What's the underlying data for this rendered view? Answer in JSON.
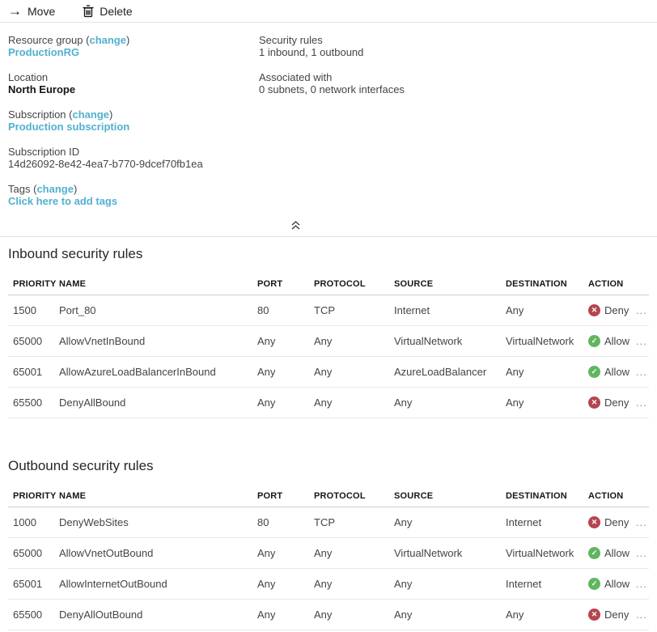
{
  "toolbar": {
    "move": "Move",
    "delete": "Delete"
  },
  "punctuation": {
    "open_paren": "(",
    "close_paren": ")"
  },
  "essentials": {
    "resource_group": {
      "label": "Resource group",
      "change": "change",
      "value": "ProductionRG"
    },
    "location": {
      "label": "Location",
      "value": "North Europe"
    },
    "subscription": {
      "label": "Subscription",
      "change": "change",
      "value": "Production subscription"
    },
    "subscription_id": {
      "label": "Subscription ID",
      "value": "14d26092-8e42-4ea7-b770-9dcef70fb1ea"
    },
    "tags": {
      "label": "Tags",
      "change": "change",
      "value": "Click here to add tags"
    },
    "security_rules": {
      "label": "Security rules",
      "value": "1 inbound, 1 outbound"
    },
    "associated_with": {
      "label": "Associated with",
      "value": "0 subnets, 0 network interfaces"
    }
  },
  "icons": {
    "move": "arrow-right-icon",
    "move_glyph": "→",
    "delete": "trash-icon",
    "collapse": "chevron-double-up-icon",
    "allow": "check-circle-icon",
    "check_glyph": "✓",
    "deny": "x-circle-icon",
    "cross_glyph": "✕"
  },
  "colors": {
    "link": "#52b0cf",
    "allow": "#60b65f",
    "deny": "#b6444f"
  },
  "misc": {
    "ellipsis": "...",
    "allow_label": "Allow",
    "deny_label": "Deny"
  },
  "tables": {
    "headers": [
      "PRIORITY",
      "NAME",
      "PORT",
      "PROTOCOL",
      "SOURCE",
      "DESTINATION",
      "ACTION"
    ],
    "inbound": {
      "title": "Inbound security rules",
      "rows": [
        {
          "priority": "1500",
          "name": "Port_80",
          "port": "80",
          "protocol": "TCP",
          "source": "Internet",
          "destination": "Any",
          "action": "Deny"
        },
        {
          "priority": "65000",
          "name": "AllowVnetInBound",
          "port": "Any",
          "protocol": "Any",
          "source": "VirtualNetwork",
          "destination": "VirtualNetwork",
          "action": "Allow"
        },
        {
          "priority": "65001",
          "name": "AllowAzureLoadBalancerInBound",
          "port": "Any",
          "protocol": "Any",
          "source": "AzureLoadBalancer",
          "destination": "Any",
          "action": "Allow"
        },
        {
          "priority": "65500",
          "name": "DenyAllBound",
          "port": "Any",
          "protocol": "Any",
          "source": "Any",
          "destination": "Any",
          "action": "Deny"
        }
      ]
    },
    "outbound": {
      "title": "Outbound security rules",
      "rows": [
        {
          "priority": "1000",
          "name": "DenyWebSites",
          "port": "80",
          "protocol": "TCP",
          "source": "Any",
          "destination": "Internet",
          "action": "Deny"
        },
        {
          "priority": "65000",
          "name": "AllowVnetOutBound",
          "port": "Any",
          "protocol": "Any",
          "source": "VirtualNetwork",
          "destination": "VirtualNetwork",
          "action": "Allow"
        },
        {
          "priority": "65001",
          "name": "AllowInternetOutBound",
          "port": "Any",
          "protocol": "Any",
          "source": "Any",
          "destination": "Internet",
          "action": "Allow"
        },
        {
          "priority": "65500",
          "name": "DenyAllOutBound",
          "port": "Any",
          "protocol": "Any",
          "source": "Any",
          "destination": "Any",
          "action": "Deny"
        }
      ]
    }
  }
}
